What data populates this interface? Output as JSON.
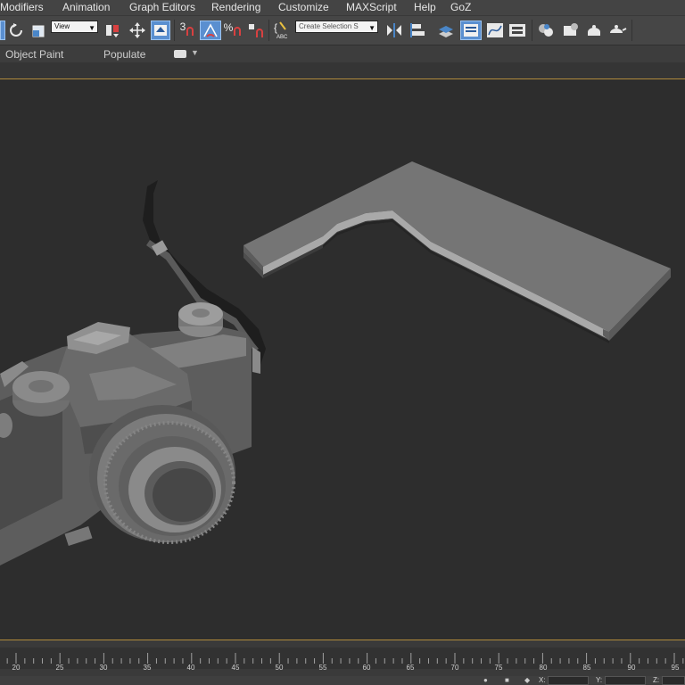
{
  "menubar": {
    "items": [
      "Modifiers",
      "Animation",
      "Graph Editors",
      "Rendering",
      "Customize",
      "MAXScript",
      "Help",
      "GoZ"
    ]
  },
  "toolbar": {
    "reference_coord": "View",
    "named_selection_placeholder": "Create Selection S",
    "snap_label": "3",
    "percent_label": "%",
    "icons": [
      "select-region-icon",
      "rotate-icon",
      "scale-icon",
      "pivot-icon",
      "move-icon",
      "manipulate-icon",
      "snap-3d-icon",
      "angle-snap-icon",
      "percent-snap-icon",
      "spinner-snap-icon",
      "edit-named-selection-icon",
      "mirror-icon",
      "align-icon",
      "layer-manager-icon",
      "toggle-scene-explorer-icon",
      "curve-editor-icon",
      "schematic-view-icon",
      "material-editor-icon",
      "render-setup-icon",
      "rendered-frame-window-icon",
      "render-production-icon"
    ]
  },
  "ribbon": {
    "tabs": [
      "Object Paint",
      "Populate"
    ]
  },
  "timeline": {
    "ticks": [
      "20",
      "25",
      "30",
      "35",
      "40",
      "45",
      "50",
      "55",
      "60",
      "65",
      "70",
      "75",
      "80",
      "85",
      "90",
      "95"
    ]
  },
  "status": {
    "x_label": "X:",
    "y_label": "Y:",
    "z_label": "Z:"
  },
  "colors": {
    "accent_active": "#5a8fd0",
    "viewport_border": "#b08a3c",
    "viewport_bg": "#2d2d2d"
  }
}
